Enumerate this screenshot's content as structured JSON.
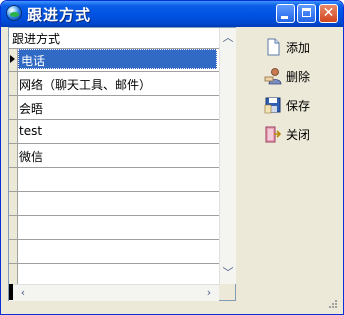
{
  "window": {
    "title": "跟进方式"
  },
  "grid": {
    "column_header": "跟进方式",
    "rows": [
      "电话",
      "网络（聊天工具、邮件）",
      "会晤",
      "test",
      "微信",
      "",
      "",
      "",
      "",
      ""
    ],
    "selected_index": 0
  },
  "actions": {
    "add": "添加",
    "delete": "删除",
    "save": "保存",
    "close": "关闭"
  }
}
